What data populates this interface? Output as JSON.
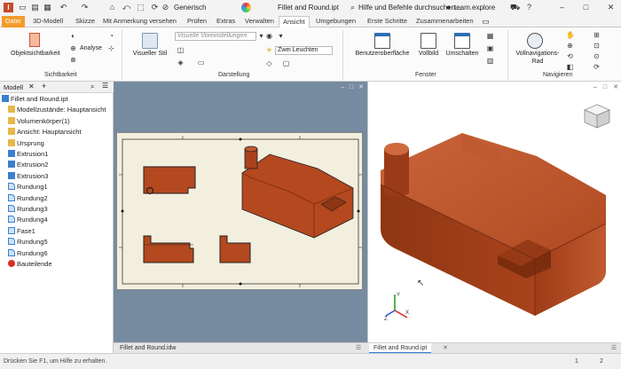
{
  "titlebar": {
    "mode_value": "Generisch",
    "document_title": "Fillet and Round.ipt",
    "search_placeholder": "Hilfe und Befehle durchsuchen...",
    "user": "team.explore",
    "qat_icons": [
      "document-icon",
      "home-icon",
      "folder-open-icon",
      "save-icon",
      "undo-icon",
      "redo-icon",
      "return-icon",
      "select-icon",
      "update-icon",
      "cancel-icon",
      "color-icon"
    ]
  },
  "tabs": [
    {
      "label": "Datei"
    },
    {
      "label": "3D-Modell"
    },
    {
      "label": "Skizze"
    },
    {
      "label": "Mit Anmerkung versehen"
    },
    {
      "label": "Prüfen"
    },
    {
      "label": "Extras"
    },
    {
      "label": "Verwalten"
    },
    {
      "label": "Ansicht"
    },
    {
      "label": "Umgebungen"
    },
    {
      "label": "Erste Schritte"
    },
    {
      "label": "Zusammenarbeiten"
    }
  ],
  "ribbon": {
    "sichtbarkeit": {
      "button": "Objektsichtbarkeit",
      "analyse": "Analyse",
      "group": "Sichtbarkeit"
    },
    "darstellung": {
      "style_button": "Visueller Stil",
      "visual_settings_placeholder": "Visuelle Voreinstellungen",
      "lighting": "Zwei Leuchten",
      "group": "Darstellung"
    },
    "fenster": {
      "user_interface": "Benutzeroberfläche",
      "fullscreen": "Vollbild",
      "switch": "Umschalten",
      "group": "Fenster"
    },
    "navigieren": {
      "wheel_line1": "Vollnavigations-",
      "wheel_line2": "Rad",
      "group": "Navigieren"
    }
  },
  "browser": {
    "tab_label": "Modell",
    "add": "+",
    "items": [
      {
        "label": "Fillet and Round.ipt",
        "icon": "part-icon",
        "indent": 0
      },
      {
        "label": "Modellzustände: Hauptansicht",
        "icon": "folder-icon",
        "indent": 1
      },
      {
        "label": "Volumenkörper(1)",
        "icon": "folder-icon",
        "indent": 1
      },
      {
        "label": "Ansicht: Hauptansicht",
        "icon": "folder-icon",
        "indent": 1
      },
      {
        "label": "Ursprung",
        "icon": "folder-icon",
        "indent": 1
      },
      {
        "label": "Extrusion1",
        "icon": "extrusion-icon",
        "indent": 1
      },
      {
        "label": "Extrusion2",
        "icon": "extrusion-icon",
        "indent": 1
      },
      {
        "label": "Extrusion3",
        "icon": "extrusion-icon",
        "indent": 1
      },
      {
        "label": "Rundung1",
        "icon": "fillet-icon",
        "indent": 1
      },
      {
        "label": "Rundung2",
        "icon": "fillet-icon",
        "indent": 1
      },
      {
        "label": "Rundung3",
        "icon": "fillet-icon",
        "indent": 1
      },
      {
        "label": "Rundung4",
        "icon": "fillet-icon",
        "indent": 1
      },
      {
        "label": "Fase1",
        "icon": "chamfer-icon",
        "indent": 1
      },
      {
        "label": "Rundung5",
        "icon": "fillet-icon",
        "indent": 1
      },
      {
        "label": "Rundung6",
        "icon": "fillet-icon",
        "indent": 1
      },
      {
        "label": "Bauteilende",
        "icon": "end-of-part-icon",
        "indent": 1
      }
    ]
  },
  "doc_tabs": [
    {
      "label": "Fillet and Round.idw",
      "active": false
    },
    {
      "label": "Fillet and Round.ipt",
      "active": true
    }
  ],
  "status": {
    "text": "Drücken Sie F1, um Hilfe zu erhalten.",
    "count1": "1",
    "count2": "2"
  },
  "colors": {
    "part": "#b4481f",
    "file_tab": "#f39b2a",
    "drawing_bg": "#778ba0",
    "sheet": "#f3efdf"
  }
}
